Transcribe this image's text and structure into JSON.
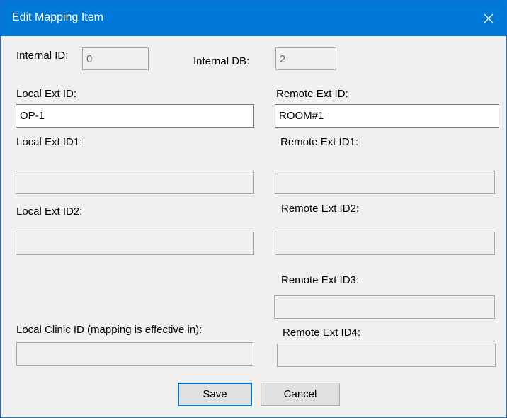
{
  "window": {
    "title": "Edit Mapping Item"
  },
  "internal": {
    "id_label": "Internal ID:",
    "id_value": "0",
    "db_label": "Internal DB:",
    "db_value": "2"
  },
  "local": {
    "ext_id_label": "Local Ext ID:",
    "ext_id_value": "OP-1",
    "ext_id1_label": "Local Ext ID1:",
    "ext_id1_value": "",
    "ext_id2_label": "Local Ext ID2:",
    "ext_id2_value": "",
    "clinic_label": "Local Clinic ID (mapping is effective in):",
    "clinic_value": ""
  },
  "remote": {
    "ext_id_label": "Remote Ext ID:",
    "ext_id_value": "ROOM#1",
    "ext_id1_label": "Remote Ext ID1:",
    "ext_id1_value": "",
    "ext_id2_label": "Remote Ext ID2:",
    "ext_id2_value": "",
    "ext_id3_label": "Remote Ext ID3:",
    "ext_id3_value": "",
    "ext_id4_label": "Remote Ext ID4:",
    "ext_id4_value": ""
  },
  "buttons": {
    "save": "Save",
    "cancel": "Cancel"
  },
  "icons": {
    "close": "close-icon"
  },
  "colors": {
    "titlebar": "#0078d7",
    "dialog_bg": "#f0f0f0",
    "default_button_border": "#0078d7"
  }
}
